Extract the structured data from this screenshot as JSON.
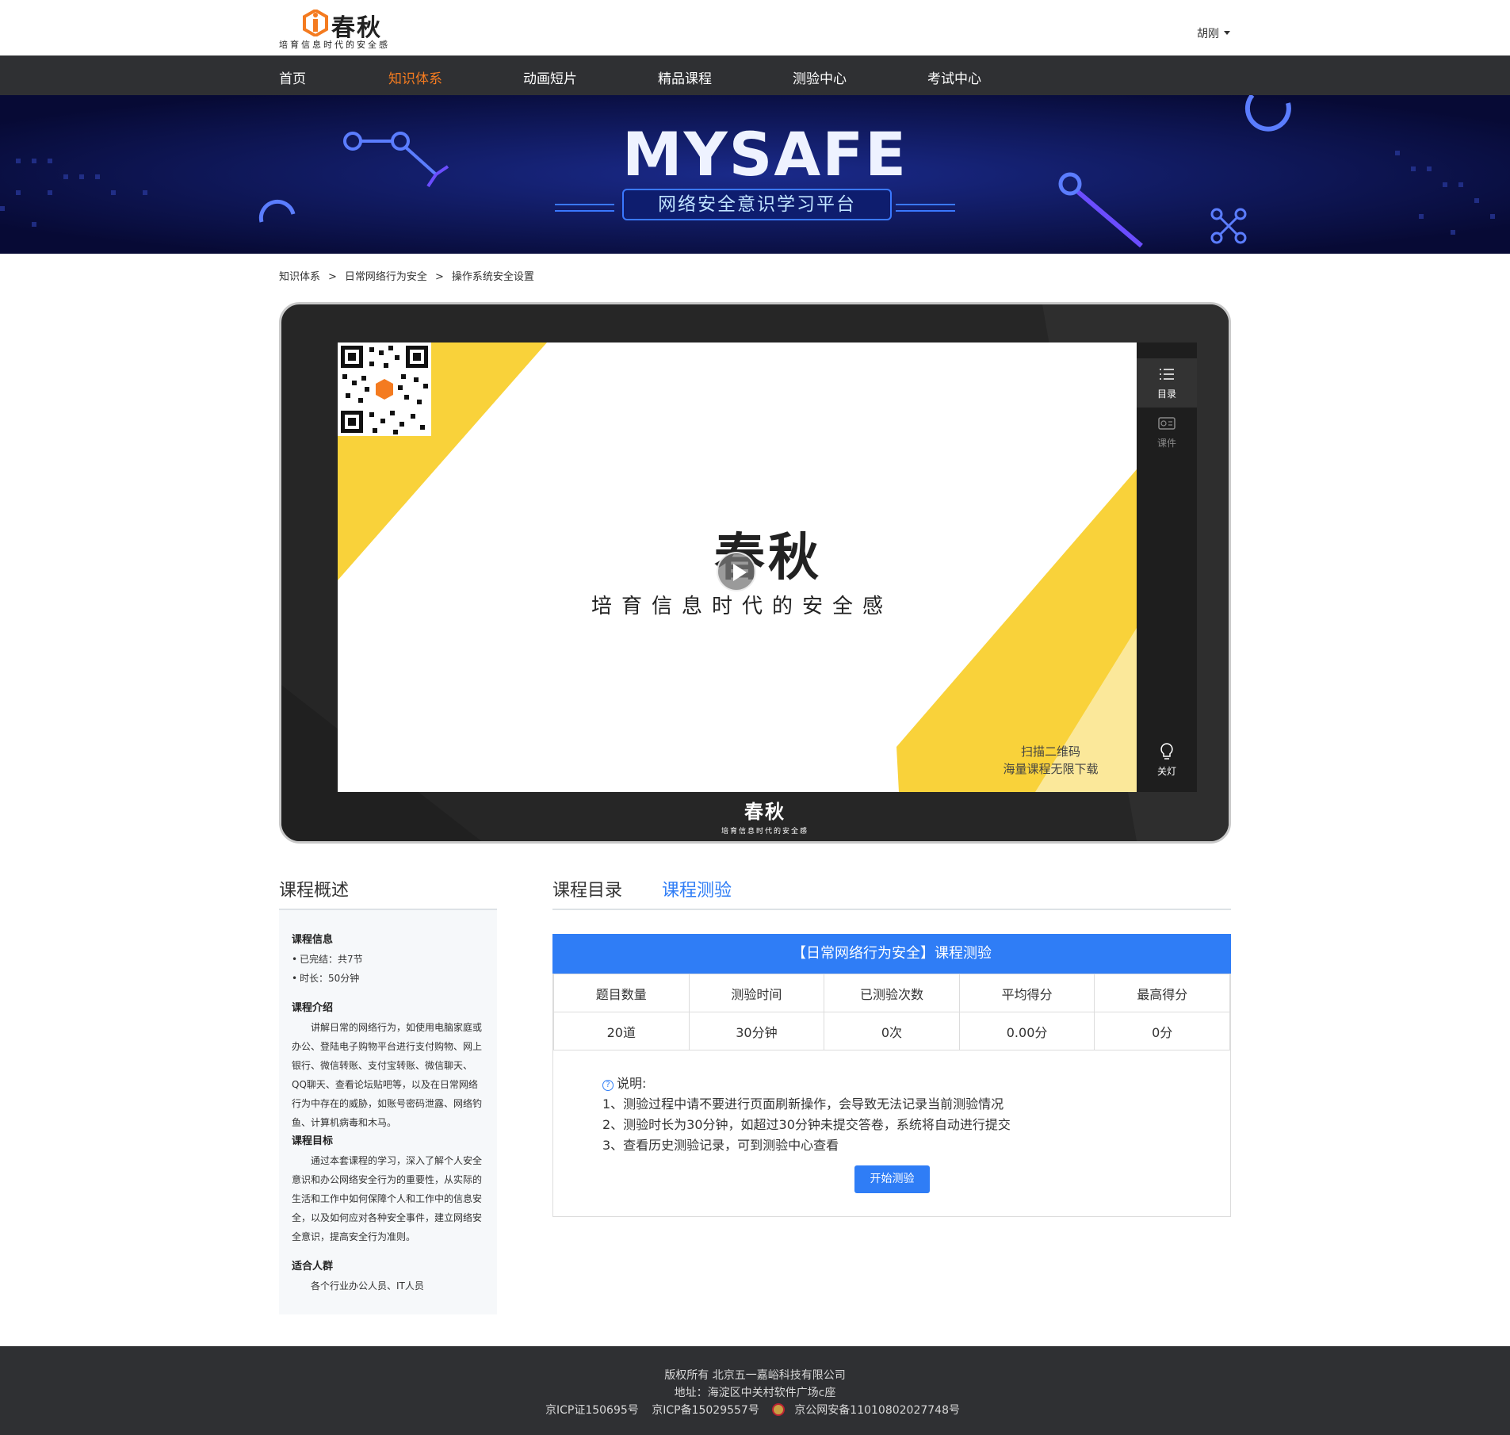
{
  "header": {
    "brand": "春秋",
    "slogan": "培育信息时代的安全感",
    "user": "胡刚"
  },
  "nav": {
    "items": [
      "首页",
      "知识体系",
      "动画短片",
      "精品课程",
      "测验中心",
      "考试中心"
    ],
    "active": "知识体系"
  },
  "banner": {
    "title": "MYSAFE",
    "subtitle": "网络安全意识学习平台"
  },
  "breadcrumb": [
    "知识体系",
    "日常网络行为安全",
    "操作系统安全设置"
  ],
  "breadcrumb_sep": ">",
  "player": {
    "screen_brand": "春秋",
    "screen_slogan": "培育信息时代的安全感",
    "qr_caption_1": "扫描二维码",
    "qr_caption_2": "海量课程无限下载",
    "side": {
      "catalog": "目录",
      "courseware": "课件",
      "lights_off": "关灯"
    },
    "footer_brand": "春秋",
    "footer_slogan": "培育信息时代的安全感"
  },
  "overview": {
    "title": "课程概述",
    "info_heading": "课程信息",
    "info_items": [
      "已完结：共7节",
      "时长：50分钟"
    ],
    "intro_heading": "课程介绍",
    "intro_text": "讲解日常的网络行为，如使用电脑家庭或办公、登陆电子购物平台进行支付购物、网上银行、微信转账、支付宝转账、微信聊天、QQ聊天、查看论坛贴吧等，以及在日常网络行为中存在的威胁，如账号密码泄露、网络钓鱼、计算机病毒和木马。",
    "goal_heading": "课程目标",
    "goal_text": "通过本套课程的学习，深入了解个人安全意识和办公网络安全行为的重要性，从实际的生活和工作中如何保障个人和工作中的信息安全，以及如何应对各种安全事件，建立网络安全意识，提高安全行为准则。",
    "audience_heading": "适合人群",
    "audience_text": "各个行业办公人员、IT人员"
  },
  "tabs": {
    "catalog": "课程目录",
    "quiz": "课程测验"
  },
  "quiz": {
    "title": "【日常网络行为安全】课程测验",
    "headers": [
      "题目数量",
      "测验时间",
      "已测验次数",
      "平均得分",
      "最高得分"
    ],
    "values": [
      "20道",
      "30分钟",
      "0次",
      "0.00分",
      "0分"
    ],
    "note_label": "说明:",
    "notes": [
      "1、测验过程中请不要进行页面刷新操作，会导致无法记录当前测验情况",
      "2、测验时长为30分钟，如超过30分钟未提交答卷，系统将自动进行提交",
      "3、查看历史测验记录，可到测验中心查看"
    ],
    "start_button": "开始测验"
  },
  "footer": {
    "copyright": "版权所有  北京五一嘉峪科技有限公司",
    "address": "地址：海淀区中关村软件广场c座",
    "icp1": "京ICP证150695号",
    "icp2": "京ICP备15029557号",
    "police": "京公网安备11010802027748号"
  },
  "colors": {
    "accent": "#2f7df6",
    "nav_active": "#f47b20",
    "nav_bg": "#2f3033",
    "banner_bg": "#0b0f45"
  }
}
